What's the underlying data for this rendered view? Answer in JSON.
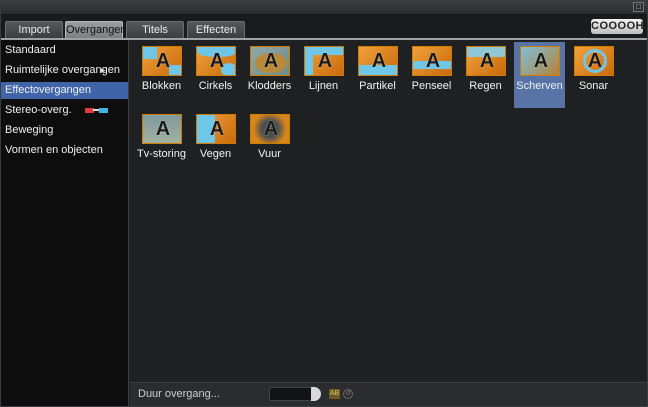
{
  "window": {
    "control_icon": "□"
  },
  "tabs": [
    {
      "label": "Import",
      "active": false
    },
    {
      "label": "Overgangen",
      "active": true
    },
    {
      "label": "Titels",
      "active": false
    },
    {
      "label": "Effecten",
      "active": false
    }
  ],
  "logo": "COOOOH",
  "sidebar": {
    "items": [
      {
        "label": "Standaard"
      },
      {
        "label": "Ruimtelijke overgangen",
        "icon": "chevron-right-icon"
      },
      {
        "label": "Effectovergangen",
        "active": true
      },
      {
        "label": "Stereo-overg.",
        "icon": "3d-glasses-icon"
      },
      {
        "label": "Beweging"
      },
      {
        "label": "Vormen en objecten"
      }
    ]
  },
  "transitions": [
    {
      "label": "Blokken",
      "glyph": "A"
    },
    {
      "label": "Cirkels",
      "glyph": "A"
    },
    {
      "label": "Klodders",
      "glyph": "A"
    },
    {
      "label": "Lijnen",
      "glyph": "A"
    },
    {
      "label": "Partikel",
      "glyph": "A"
    },
    {
      "label": "Penseel",
      "glyph": "A"
    },
    {
      "label": "Regen",
      "glyph": "A"
    },
    {
      "label": "Scherven",
      "glyph": "A",
      "selected": true
    },
    {
      "label": "Sonar",
      "glyph": "A"
    },
    {
      "label": "Tv-storing",
      "glyph": "A"
    },
    {
      "label": "Vegen",
      "glyph": "A"
    },
    {
      "label": "Vuur",
      "glyph": "A"
    }
  ],
  "bottom": {
    "duur_label": "Duur overgang...",
    "duur_value": "",
    "ab_icon": "AB",
    "reset_icon": "↺"
  },
  "colors": {
    "accent": "#3f64a8",
    "selected_tile": "#5873a6",
    "thumb_orange": "#e88f22",
    "thumb_blue": "#6ec6e8"
  }
}
